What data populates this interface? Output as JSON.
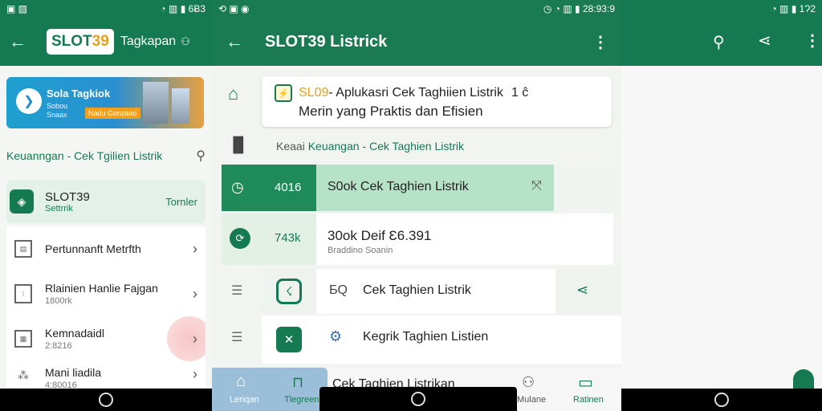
{
  "left": {
    "status": {
      "time": "6Ƀ3"
    },
    "header": {
      "brand_main": "SLOT",
      "brand_num": "39",
      "title": "Tagkapan"
    },
    "banner": {
      "title": "Sola Tagkiok",
      "line1": "Sobou",
      "line2": "Snaax",
      "badge": "Nadu Gonzaeo"
    },
    "breadcrumb": "Keuanngan - Cek Tgilien Listrik",
    "selected": {
      "title": "SLOT39",
      "sub": "Settrrik",
      "action": "Tornler"
    },
    "items": [
      {
        "title": "Pertunnanft Metrfth",
        "sub": ""
      },
      {
        "title": "Rlainien Hanlie Fajgan",
        "sub": "1800rk"
      },
      {
        "title": "Kemnadaidl",
        "sub": "2:8216"
      },
      {
        "title": "Mani liadila",
        "sub": "4:80016"
      }
    ]
  },
  "mid": {
    "status": {
      "time": "28:93:9"
    },
    "header": {
      "title": "SLOT39 Listrick"
    },
    "card": {
      "prefix": "SL09",
      "line1": " - Aplukasri Cek Taghiien Listrik",
      "tail": "1 ĉ",
      "line2": "Merin yang  Praktis dan Efisien"
    },
    "breadcrumb": {
      "lead": "Keaai ",
      "rest": "Keuangan - Cek Taghien Listrik"
    },
    "rows": [
      {
        "num": "4016",
        "title": "S0ok Cek Taghien Listrik",
        "sub": ""
      },
      {
        "num": "743k",
        "title": "30ok Deif Ɛ6.391",
        "sub": "Braddino Soanin"
      },
      {
        "num": "",
        "title": "Cek Taghien Listrik",
        "sub": "",
        "prefix": "ƂQ"
      },
      {
        "num": "",
        "title": "Kegrik Taghien Listien",
        "sub": ""
      }
    ],
    "bottomnav": [
      {
        "label": "Lenqan"
      },
      {
        "label": "Tlegreen"
      },
      {
        "label": "Cek Taghien Listrikan"
      },
      {
        "label": "Mulane"
      },
      {
        "label": "Ratinen"
      }
    ]
  },
  "right": {
    "status": {
      "time": "1Ɂ2"
    }
  },
  "colors": {
    "primary": "#157a52",
    "accent": "#e6a020"
  }
}
